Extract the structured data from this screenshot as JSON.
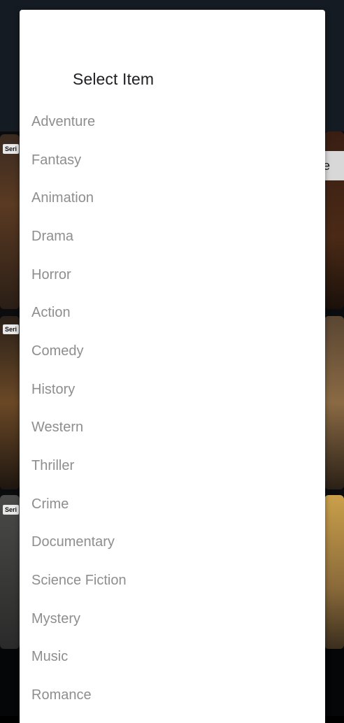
{
  "dialog": {
    "title": "Select Item",
    "items": [
      "Adventure",
      "Fantasy",
      "Animation",
      "Drama",
      "Horror",
      "Action",
      "Comedy",
      "History",
      "Western",
      "Thriller",
      "Crime",
      "Documentary",
      "Science Fiction",
      "Mystery",
      "Music",
      "Romance"
    ]
  },
  "background": {
    "poster_tags": [
      "Seri",
      "Seri",
      "Seri"
    ],
    "right_label": "e"
  },
  "colors": {
    "dialog_background": "#ffffff",
    "title_text": "#202124",
    "item_text": "#8e8e8e",
    "scrim": "#000000"
  }
}
